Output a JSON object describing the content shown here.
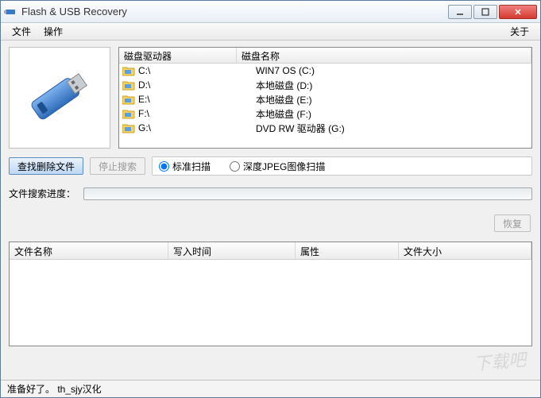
{
  "window": {
    "title": "Flash & USB Recovery"
  },
  "menu": {
    "file": "文件",
    "operate": "操作",
    "about": "关于"
  },
  "drives": {
    "header": {
      "drive": "磁盘驱动器",
      "name": "磁盘名称"
    },
    "rows": [
      {
        "letter": "C:\\",
        "label": "WIN7 OS (C:)"
      },
      {
        "letter": "D:\\",
        "label": "本地磁盘 (D:)"
      },
      {
        "letter": "E:\\",
        "label": "本地磁盘 (E:)"
      },
      {
        "letter": "F:\\",
        "label": "本地磁盘 (F:)"
      },
      {
        "letter": "G:\\",
        "label": "DVD RW 驱动器 (G:)"
      }
    ]
  },
  "buttons": {
    "scan": "查找删除文件",
    "stop": "停止搜索",
    "recover": "恢复"
  },
  "scanmode": {
    "standard": "标准扫描",
    "deepjpeg": "深度JPEG图像扫描",
    "selected": "standard"
  },
  "progress": {
    "label": "文件搜索进度："
  },
  "results": {
    "header": {
      "name": "文件名称",
      "wtime": "写入时间",
      "attr": "属性",
      "size": "文件大小"
    }
  },
  "status": {
    "text": "准备好了。 th_sjy汉化"
  },
  "watermark": "下载吧"
}
